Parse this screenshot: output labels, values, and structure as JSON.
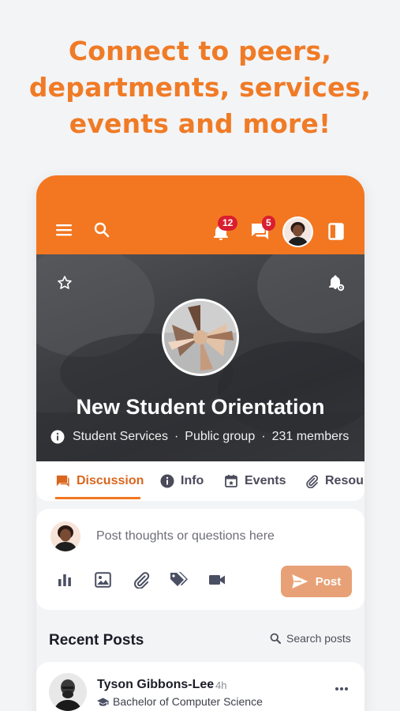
{
  "headline": {
    "line1": "Connect to peers,",
    "line2": "departments, services,",
    "line3": "events and more!"
  },
  "topbar": {
    "notification_count": "12",
    "message_count": "5",
    "icons": [
      "menu-icon",
      "search-icon",
      "bell-icon",
      "chat-icon",
      "avatar",
      "panel-icon"
    ]
  },
  "group": {
    "title": "New Student Orientation",
    "organizer": "Student Services",
    "privacy": "Public group",
    "members": "231 members",
    "separator": "·"
  },
  "tabs": [
    {
      "label": "Discussion",
      "icon": "discussion-icon",
      "active": true
    },
    {
      "label": "Info",
      "icon": "info-icon",
      "active": false
    },
    {
      "label": "Events",
      "icon": "calendar-icon",
      "active": false
    },
    {
      "label": "Resour",
      "icon": "paperclip-icon",
      "active": false
    }
  ],
  "composer": {
    "placeholder": "Post thoughts or questions here",
    "post_label": "Post",
    "icons": [
      "poll-icon",
      "image-icon",
      "attachment-icon",
      "tag-icon",
      "video-icon"
    ]
  },
  "recent": {
    "title": "Recent Posts",
    "search_label": "Search posts"
  },
  "posts": [
    {
      "author": "Tyson Gibbons-Lee",
      "time": "4h",
      "degree": "Bachelor of Computer Science"
    }
  ],
  "colors": {
    "brand": "#f37721",
    "headline": "#f07b26",
    "badge": "#d91f2f",
    "post_button": "#e8a177"
  }
}
